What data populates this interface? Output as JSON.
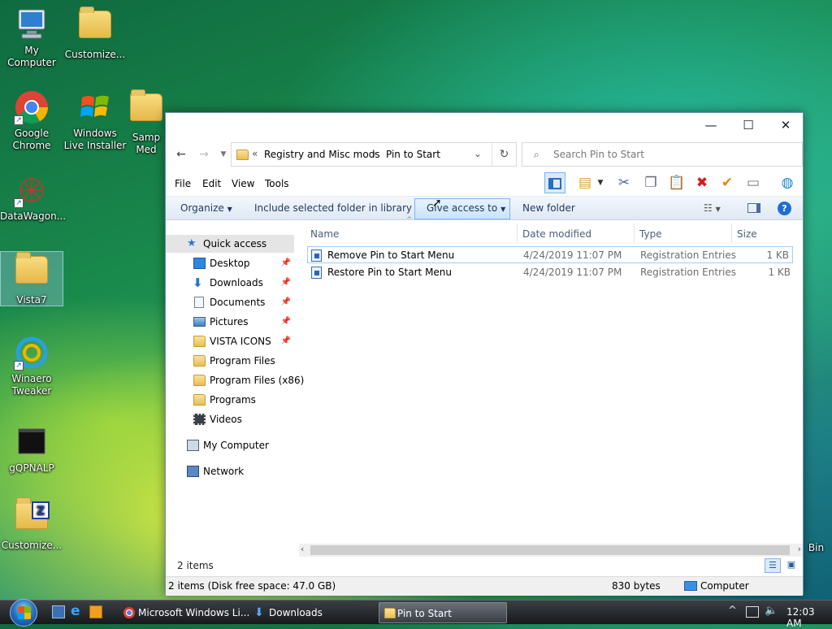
{
  "desktop": {
    "icons": [
      {
        "label": "My Computer"
      },
      {
        "label": "Customize..."
      },
      {
        "label": "Google Chrome"
      },
      {
        "label": "Windows Live Installer"
      },
      {
        "label": "Samp Med"
      },
      {
        "label": "DataWagon..."
      },
      {
        "label": "Vista7"
      },
      {
        "label": "Winaero Tweaker"
      },
      {
        "label": "gQPNALP"
      },
      {
        "label": "Customize..."
      },
      {
        "label": "Bin"
      }
    ]
  },
  "window": {
    "controls": {
      "minimize": "—",
      "maximize": "☐",
      "close": "✕"
    },
    "address": {
      "overflow": "«",
      "crumbs": [
        "Registry and Misc mods",
        "Pin to Start"
      ],
      "separator": "›"
    },
    "search": {
      "placeholder": "Search Pin to Start"
    },
    "menu": [
      "File",
      "Edit",
      "View",
      "Tools"
    ],
    "commands": {
      "organize": "Organize",
      "include": "Include selected folder in library",
      "give_access": "Give access to",
      "new_folder": "New folder"
    },
    "nav": {
      "quick_access": "Quick access",
      "items": [
        {
          "label": "Desktop",
          "pinned": "📌"
        },
        {
          "label": "Downloads",
          "pinned": "📌"
        },
        {
          "label": "Documents",
          "pinned": "📌"
        },
        {
          "label": "Pictures",
          "pinned": "📌"
        },
        {
          "label": "VISTA ICONS",
          "pinned": "📌"
        },
        {
          "label": "Program Files"
        },
        {
          "label": "Program Files (x86)"
        },
        {
          "label": "Programs"
        },
        {
          "label": "Videos"
        }
      ],
      "my_computer": "My Computer",
      "network": "Network"
    },
    "columns": {
      "name": "Name",
      "date": "Date modified",
      "type": "Type",
      "size": "Size"
    },
    "files": [
      {
        "name": "Remove Pin to Start Menu",
        "date": "4/24/2019 11:07 PM",
        "type": "Registration Entries",
        "size": "1 KB"
      },
      {
        "name": "Restore Pin to Start Menu",
        "date": "4/24/2019 11:07 PM",
        "type": "Registration Entries",
        "size": "1 KB"
      }
    ],
    "status": {
      "item_count": "2 items"
    },
    "details": {
      "summary": "2 items (Disk free space: 47.0 GB)",
      "size": "830 bytes",
      "location": "Computer"
    }
  },
  "taskbar": {
    "buttons": [
      {
        "label": "Microsoft Windows Li..."
      },
      {
        "label": "Downloads"
      },
      {
        "label": "Pin to Start"
      }
    ],
    "clock": "12:03 AM"
  }
}
